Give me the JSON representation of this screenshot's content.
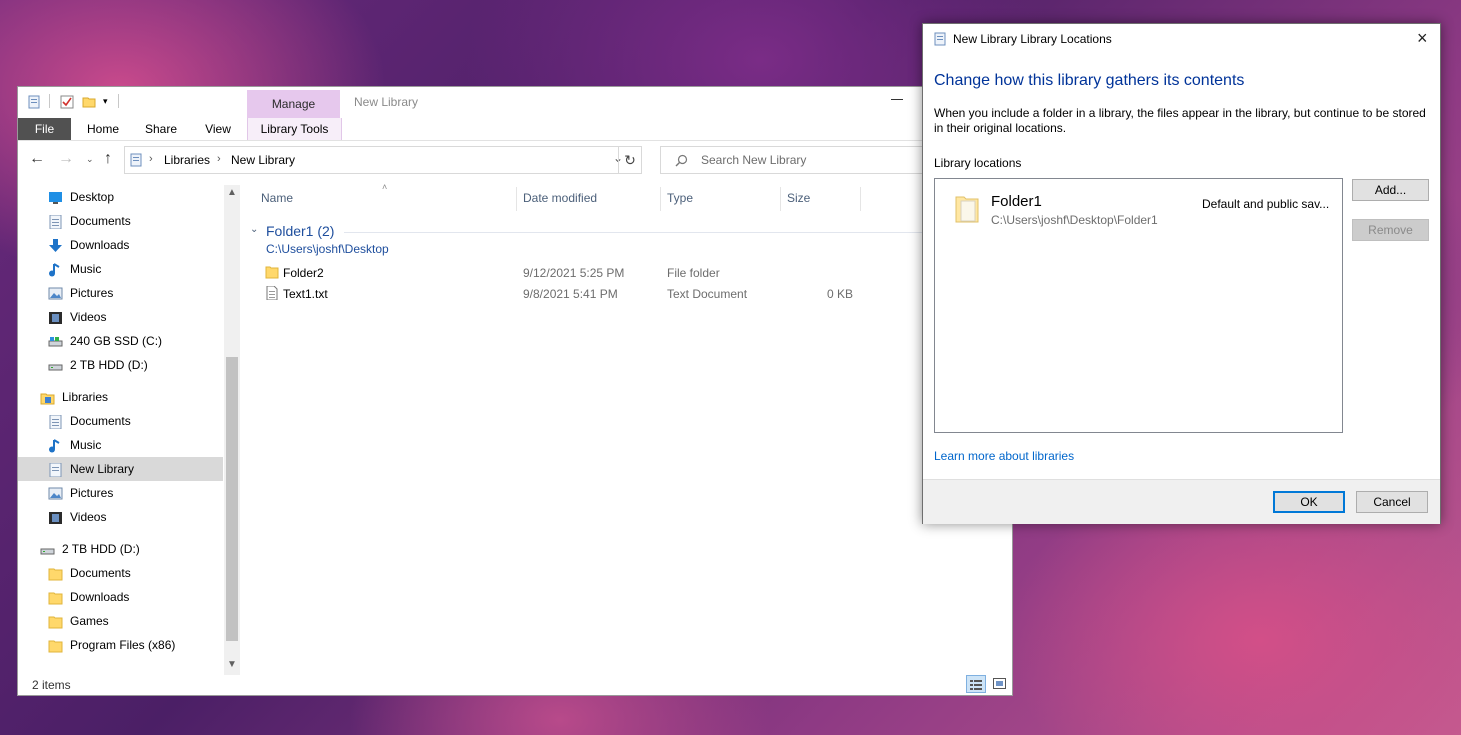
{
  "explorer": {
    "window_title": "New Library",
    "ribbon": {
      "context_tab": "Manage",
      "context_group": "Library Tools",
      "tabs": [
        "File",
        "Home",
        "Share",
        "View"
      ]
    },
    "address": {
      "crumbs": [
        "Libraries",
        "New Library"
      ],
      "search_placeholder": "Search New Library"
    },
    "nav": {
      "items": [
        {
          "label": "Desktop",
          "icon": "desktop-icon"
        },
        {
          "label": "Documents",
          "icon": "documents-icon"
        },
        {
          "label": "Downloads",
          "icon": "downloads-icon"
        },
        {
          "label": "Music",
          "icon": "music-icon"
        },
        {
          "label": "Pictures",
          "icon": "pictures-icon"
        },
        {
          "label": "Videos",
          "icon": "videos-icon"
        },
        {
          "label": "240 GB SSD (C:)",
          "icon": "drive-icon"
        },
        {
          "label": "2 TB HDD (D:)",
          "icon": "drive-icon"
        },
        {
          "label": "Libraries",
          "icon": "libraries-icon"
        },
        {
          "label": "Documents",
          "icon": "documents-icon"
        },
        {
          "label": "Music",
          "icon": "music-icon"
        },
        {
          "label": "New Library",
          "icon": "library-icon"
        },
        {
          "label": "Pictures",
          "icon": "pictures-icon"
        },
        {
          "label": "Videos",
          "icon": "videos-icon"
        },
        {
          "label": "2 TB HDD (D:)",
          "icon": "drive-icon"
        },
        {
          "label": "Documents",
          "icon": "folder-icon"
        },
        {
          "label": "Downloads",
          "icon": "folder-icon"
        },
        {
          "label": "Games",
          "icon": "folder-icon"
        },
        {
          "label": "Program Files (x86)",
          "icon": "folder-icon"
        }
      ],
      "selected": "New Library"
    },
    "columns": [
      "Name",
      "Date modified",
      "Type",
      "Size"
    ],
    "group": {
      "title": "Folder1 (2)",
      "path": "C:\\Users\\joshf\\Desktop"
    },
    "files": [
      {
        "name": "Folder2",
        "date": "9/12/2021 5:25 PM",
        "type": "File folder",
        "size": "",
        "icon": "folder-icon"
      },
      {
        "name": "Text1.txt",
        "date": "9/8/2021 5:41 PM",
        "type": "Text Document",
        "size": "0 KB",
        "icon": "text-file-icon"
      }
    ],
    "status": "2 items"
  },
  "dialog": {
    "title": "New Library Library Locations",
    "heading": "Change how this library gathers its contents",
    "description": "When you include a folder in a library, the files appear in the library, but continue to be stored in their original locations.",
    "locations_label": "Library locations",
    "location": {
      "name": "Folder1",
      "path": "C:\\Users\\joshf\\Desktop\\Folder1",
      "status": "Default and public sav..."
    },
    "add_label": "Add...",
    "remove_label": "Remove",
    "learn_more": "Learn more about libraries",
    "ok_label": "OK",
    "cancel_label": "Cancel"
  },
  "colors": {
    "accent_blue": "#003399",
    "link_blue": "#0066cc",
    "manage_purple": "#e6c8ed",
    "selected_row": "#d9d9d9"
  }
}
